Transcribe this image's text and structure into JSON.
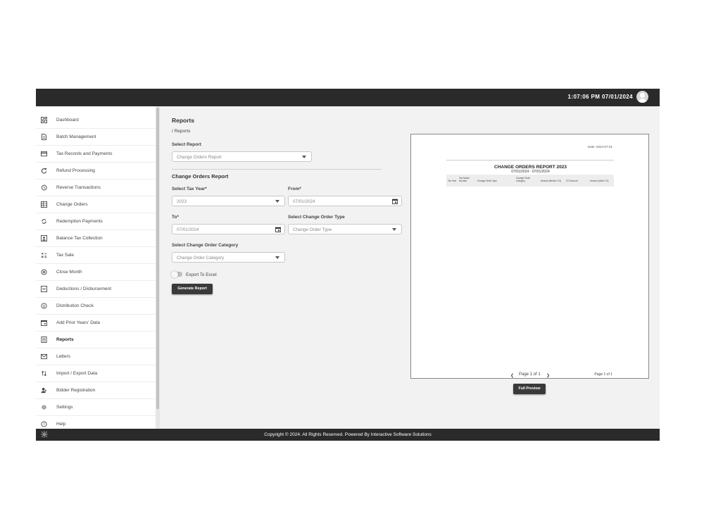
{
  "header": {
    "datetime": "1:07:06 PM 07/01/2024"
  },
  "sidebar": {
    "items": [
      {
        "label": "Dashboard",
        "icon": "dashboard-icon"
      },
      {
        "label": "Batch Management",
        "icon": "document-icon"
      },
      {
        "label": "Tax Records and Payments",
        "icon": "card-icon"
      },
      {
        "label": "Refund Processing",
        "icon": "refresh-icon"
      },
      {
        "label": "Reverse Transactions",
        "icon": "history-icon"
      },
      {
        "label": "Change Orders",
        "icon": "ledger-icon"
      },
      {
        "label": "Redemption Payments",
        "icon": "cycle-icon"
      },
      {
        "label": "Balance Tax Collection",
        "icon": "account-box-icon"
      },
      {
        "label": "Tax Sale",
        "icon": "calculator-icon"
      },
      {
        "label": "Close Month",
        "icon": "cancel-circle-icon"
      },
      {
        "label": "Deductions / Disbursement",
        "icon": "minus-box-icon"
      },
      {
        "label": "Distribution Check",
        "icon": "dollar-circle-icon"
      },
      {
        "label": "Add Prior Years' Data",
        "icon": "calendar-icon"
      },
      {
        "label": "Reports",
        "icon": "report-icon",
        "active": true
      },
      {
        "label": "Letters",
        "icon": "mail-icon"
      },
      {
        "label": "Import / Export Data",
        "icon": "import-export-icon"
      },
      {
        "label": "Bidder Registration",
        "icon": "person-add-icon"
      },
      {
        "label": "Settings",
        "icon": "gear-icon"
      },
      {
        "label": "Help",
        "icon": "help-icon"
      }
    ]
  },
  "main": {
    "title": "Reports",
    "breadcrumb": "/ Reports",
    "select_report_label": "Select Report",
    "select_report_value": "Change Orders Report",
    "section_title": "Change Orders Report",
    "tax_year_label": "Select Tax Year*",
    "tax_year_value": "2023",
    "from_label": "From*",
    "from_value": "07/01/2024",
    "to_label": "To*",
    "to_value": "07/01/2024",
    "order_type_label": "Select Change Order Type",
    "order_type_placeholder": "Change Order Type",
    "order_category_label": "Select Change Order Category",
    "order_category_placeholder": "Change Order Category",
    "export_label": "Export To Excel",
    "export_enabled": false,
    "generate_button": "Generate Report"
  },
  "preview": {
    "date": "Date: 2024-07-01",
    "title": "CHANGE ORDERS REPORT 2023",
    "subtitle": "07/01/2024 - 07/01/2024",
    "columns": [
      "Tax Year",
      "Tax Notice Number",
      "Change Order Type",
      "Change Order Category",
      "Amount (Before CO)",
      "CO Amount",
      "Amount (After CO)"
    ],
    "pagination": "Page 1 of 1",
    "page_footer": "Page 1 of 1",
    "full_preview_button": "Full Preview"
  },
  "footer": {
    "copyright": "Copyright © 2024. All Rights Reserved. Powered By Interactive Software Solutions"
  },
  "colors": {
    "header_bg": "#2a2a2a",
    "button_bg": "#3a3a3a",
    "content_bg": "#f2f2f2"
  }
}
